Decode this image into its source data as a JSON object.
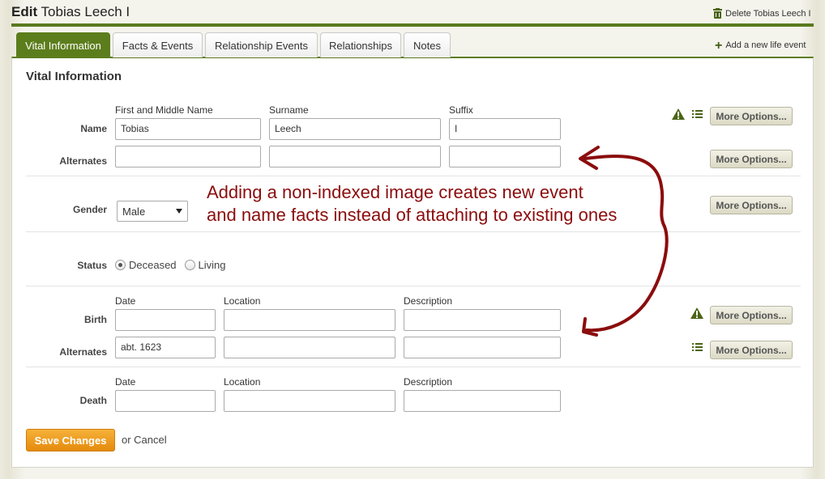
{
  "header": {
    "edit_word": "Edit",
    "person_name": "Tobias Leech I",
    "delete_label": "Delete Tobias Leech I"
  },
  "tabs": [
    {
      "label": "Vital Information",
      "active": true
    },
    {
      "label": "Facts & Events",
      "active": false
    },
    {
      "label": "Relationship Events",
      "active": false
    },
    {
      "label": "Relationships",
      "active": false
    },
    {
      "label": "Notes",
      "active": false
    }
  ],
  "add_event_label": "Add a new life event",
  "section_title": "Vital Information",
  "name": {
    "label": "Name",
    "col_first": "First and Middle Name",
    "col_surname": "Surname",
    "col_suffix": "Suffix",
    "first_value": "Tobias",
    "surname_value": "Leech",
    "suffix_value": "I",
    "alternates_label": "Alternates"
  },
  "gender": {
    "label": "Gender",
    "selected": "Male"
  },
  "status": {
    "label": "Status",
    "options": [
      "Deceased",
      "Living"
    ],
    "selected": "Deceased"
  },
  "birth": {
    "label": "Birth",
    "col_date": "Date",
    "col_location": "Location",
    "col_description": "Description",
    "alternates_label": "Alternates",
    "alternate_date": "abt. 1623"
  },
  "death": {
    "label": "Death",
    "col_date": "Date",
    "col_location": "Location",
    "col_description": "Description"
  },
  "more_options_label": "More Options...",
  "annotation": {
    "line1": "Adding a non-indexed image creates new event",
    "line2": "and name facts instead of attaching to existing ones"
  },
  "footer": {
    "save_label": "Save Changes",
    "cancel_label": "or Cancel"
  },
  "colors": {
    "brand_green": "#5c7d1c",
    "save_orange": "#e58b0c",
    "annotation_red": "#8b0d0d"
  }
}
